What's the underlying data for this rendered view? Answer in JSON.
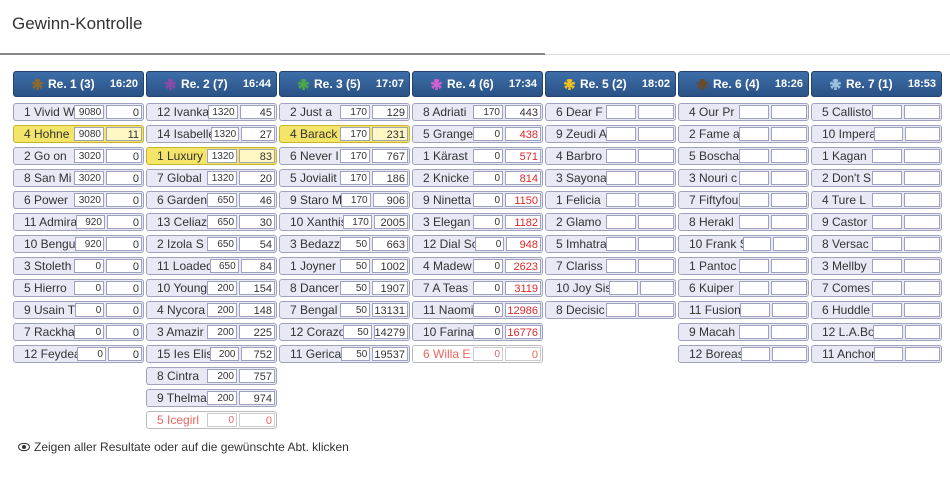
{
  "page": {
    "title": "Gewinn-Kontrolle",
    "footer_text": "Zeigen aller Resultate oder auf die gewünschte Abt. klicken"
  },
  "races": [
    {
      "name": "Re. 1 (3)",
      "time": "16:20",
      "icon_color": "#8b6a2a",
      "rows": [
        {
          "name": "1 Vivid W",
          "bet": "9080",
          "pay": "0"
        },
        {
          "name": "4 Hohne",
          "bet": "9080",
          "pay": "11",
          "highlight": true
        },
        {
          "name": "2 Go on",
          "bet": "3020",
          "pay": "0"
        },
        {
          "name": "8 San Mi",
          "bet": "3020",
          "pay": "0"
        },
        {
          "name": "6 Power",
          "bet": "3020",
          "pay": "0"
        },
        {
          "name": "11 Admira",
          "bet": "920",
          "pay": "0"
        },
        {
          "name": "10 Bengu",
          "bet": "920",
          "pay": "0"
        },
        {
          "name": "3 Stoleth",
          "bet": "0",
          "pay": "0"
        },
        {
          "name": "5 Hierro",
          "bet": "0",
          "pay": "0"
        },
        {
          "name": "9 Usain T",
          "bet": "0",
          "pay": "0"
        },
        {
          "name": "7 Rackha",
          "bet": "0",
          "pay": "0"
        },
        {
          "name": "12 Feydea",
          "bet": "0",
          "pay": "0"
        }
      ]
    },
    {
      "name": "Re. 2 (7)",
      "time": "16:44",
      "icon_color": "#8a4aa8",
      "rows": [
        {
          "name": "12 Ivanka",
          "bet": "1320",
          "pay": "45"
        },
        {
          "name": "14 Isabelle",
          "bet": "1320",
          "pay": "27"
        },
        {
          "name": "1 Luxury",
          "bet": "1320",
          "pay": "83",
          "highlight": true
        },
        {
          "name": "7 Global",
          "bet": "1320",
          "pay": "20"
        },
        {
          "name": "6 Garden",
          "bet": "650",
          "pay": "46"
        },
        {
          "name": "13 Celiaz",
          "bet": "650",
          "pay": "30"
        },
        {
          "name": "2 Izola S",
          "bet": "650",
          "pay": "54"
        },
        {
          "name": "11 Loaded",
          "bet": "650",
          "pay": "84"
        },
        {
          "name": "10 Young",
          "bet": "200",
          "pay": "154"
        },
        {
          "name": "4 Nycora",
          "bet": "200",
          "pay": "148"
        },
        {
          "name": "3 Amazir",
          "bet": "200",
          "pay": "225"
        },
        {
          "name": "15 Ies Elis",
          "bet": "200",
          "pay": "752"
        },
        {
          "name": "8 Cintra",
          "bet": "200",
          "pay": "757"
        },
        {
          "name": "9 Thelma",
          "bet": "200",
          "pay": "974"
        },
        {
          "name": "5 Icegirl",
          "bet": "0",
          "pay": "0",
          "scratched": true
        }
      ]
    },
    {
      "name": "Re. 3 (5)",
      "time": "17:07",
      "icon_color": "#4aa84a",
      "rows": [
        {
          "name": "2 Just a",
          "bet": "170",
          "pay": "129"
        },
        {
          "name": "4 Barack",
          "bet": "170",
          "pay": "231",
          "highlight": true
        },
        {
          "name": "6 Never I",
          "bet": "170",
          "pay": "767"
        },
        {
          "name": "5 Jovialit",
          "bet": "170",
          "pay": "186"
        },
        {
          "name": "9 Staro M",
          "bet": "170",
          "pay": "906"
        },
        {
          "name": "10 Xanthis",
          "bet": "170",
          "pay": "2005"
        },
        {
          "name": "3 Bedazz",
          "bet": "50",
          "pay": "663"
        },
        {
          "name": "1 Joyner",
          "bet": "50",
          "pay": "1002"
        },
        {
          "name": "8 Dancer",
          "bet": "50",
          "pay": "1907"
        },
        {
          "name": "7 Bengal",
          "bet": "50",
          "pay": "13131"
        },
        {
          "name": "12 Corazo",
          "bet": "50",
          "pay": "14279"
        },
        {
          "name": "11 Gerica",
          "bet": "50",
          "pay": "19537"
        }
      ]
    },
    {
      "name": "Re. 4 (6)",
      "time": "17:34",
      "icon_color": "#d060d0",
      "rows": [
        {
          "name": "8 Adriati",
          "bet": "170",
          "pay": "443"
        },
        {
          "name": "5 Grange",
          "bet": "0",
          "pay": "438",
          "red": true
        },
        {
          "name": "1 Kärast",
          "bet": "0",
          "pay": "571",
          "red": true
        },
        {
          "name": "2 Knicke",
          "bet": "0",
          "pay": "814",
          "red": true
        },
        {
          "name": "9 Ninetta",
          "bet": "0",
          "pay": "1150",
          "red": true
        },
        {
          "name": "3 Elegan",
          "bet": "0",
          "pay": "1182",
          "red": true
        },
        {
          "name": "12 Dial Sc",
          "bet": "0",
          "pay": "948",
          "red": true
        },
        {
          "name": "4 Madew",
          "bet": "0",
          "pay": "2623",
          "red": true
        },
        {
          "name": "7 A Teas",
          "bet": "0",
          "pay": "3119",
          "red": true
        },
        {
          "name": "11 Naomi",
          "bet": "0",
          "pay": "12986",
          "red": true
        },
        {
          "name": "10 Farina",
          "bet": "0",
          "pay": "16776",
          "red": true
        },
        {
          "name": "6 Willa E",
          "bet": "0",
          "pay": "0",
          "scratched": true
        }
      ]
    },
    {
      "name": "Re. 5 (2)",
      "time": "18:02",
      "icon_color": "#f0c020",
      "rows": [
        {
          "name": "6 Dear F",
          "bet": "",
          "pay": ""
        },
        {
          "name": "9 Zeudi A",
          "bet": "",
          "pay": ""
        },
        {
          "name": "4 Barbro",
          "bet": "",
          "pay": ""
        },
        {
          "name": "3 Sayona",
          "bet": "",
          "pay": ""
        },
        {
          "name": "1 Felicia",
          "bet": "",
          "pay": ""
        },
        {
          "name": "2 Glamo",
          "bet": "",
          "pay": ""
        },
        {
          "name": "5 Imhatra",
          "bet": "",
          "pay": ""
        },
        {
          "name": "7 Clariss",
          "bet": "",
          "pay": ""
        },
        {
          "name": "10 Joy Sis",
          "bet": "",
          "pay": ""
        },
        {
          "name": "8 Decisic",
          "bet": "",
          "pay": ""
        }
      ]
    },
    {
      "name": "Re. 6 (4)",
      "time": "18:26",
      "icon_color": "#6a4a2a",
      "rows": [
        {
          "name": "4 Our Pr",
          "bet": "",
          "pay": ""
        },
        {
          "name": "2 Fame a",
          "bet": "",
          "pay": ""
        },
        {
          "name": "5 Boscha",
          "bet": "",
          "pay": ""
        },
        {
          "name": "3 Nouri c",
          "bet": "",
          "pay": ""
        },
        {
          "name": "7 Fiftyfou",
          "bet": "",
          "pay": ""
        },
        {
          "name": "8 Herakl",
          "bet": "",
          "pay": ""
        },
        {
          "name": "10 Frank S",
          "bet": "",
          "pay": ""
        },
        {
          "name": "1 Pantoc",
          "bet": "",
          "pay": ""
        },
        {
          "name": "6 Kuiper",
          "bet": "",
          "pay": ""
        },
        {
          "name": "11 Fusion",
          "bet": "",
          "pay": ""
        },
        {
          "name": "9 Macah",
          "bet": "",
          "pay": ""
        },
        {
          "name": "12 Boreas",
          "bet": "",
          "pay": ""
        }
      ]
    },
    {
      "name": "Re. 7 (1)",
      "time": "18:53",
      "icon_color": "#9ac0e0",
      "rows": [
        {
          "name": "5 Callisto",
          "bet": "",
          "pay": ""
        },
        {
          "name": "10 Impera",
          "bet": "",
          "pay": ""
        },
        {
          "name": "1 Kagan",
          "bet": "",
          "pay": ""
        },
        {
          "name": "2 Don't S",
          "bet": "",
          "pay": ""
        },
        {
          "name": "4 Ture L",
          "bet": "",
          "pay": ""
        },
        {
          "name": "9 Castor",
          "bet": "",
          "pay": ""
        },
        {
          "name": "8 Versac",
          "bet": "",
          "pay": ""
        },
        {
          "name": "3 Mellby",
          "bet": "",
          "pay": ""
        },
        {
          "name": "7 Comes",
          "bet": "",
          "pay": ""
        },
        {
          "name": "6 Huddle",
          "bet": "",
          "pay": ""
        },
        {
          "name": "12 L.A.Bo",
          "bet": "",
          "pay": ""
        },
        {
          "name": "11 Anchor",
          "bet": "",
          "pay": ""
        }
      ]
    }
  ]
}
